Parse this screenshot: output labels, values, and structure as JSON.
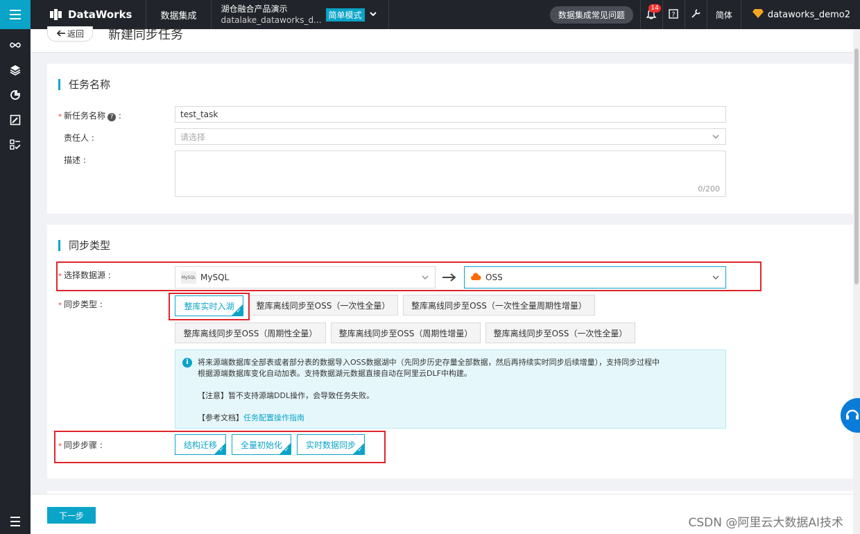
{
  "topbar": {
    "brand": "DataWorks",
    "nav_label": "数据集成",
    "workspace_name": "湖仓融合产品演示",
    "workspace_id": "datalake_dataworks_d...",
    "mode": "简单模式",
    "faq": "数据集成常见问题",
    "notif_count": "14",
    "lang": "简体",
    "user": "dataworks_demo2"
  },
  "header": {
    "back": "返回",
    "title": "新建同步任务"
  },
  "section1": {
    "title": "任务名称",
    "task_name_label": "新任务名称",
    "task_name_value": "test_task",
    "owner_label": "责任人",
    "owner_placeholder": "请选择",
    "desc_label": "描述",
    "desc_counter": "0/200"
  },
  "section2": {
    "title": "同步类型",
    "datasource_label": "选择数据源",
    "source": "MySQL",
    "source_logo": "MySQL",
    "target": "OSS",
    "sync_type_label": "同步类型",
    "sync_types": [
      "整库实时入湖",
      "整库离线同步至OSS（一次性全量）",
      "整库离线同步至OSS（一次性全量周期性增量）",
      "整库离线同步至OSS（周期性全量）",
      "整库离线同步至OSS（周期性增量）",
      "整库离线同步至OSS（一次性全量）"
    ],
    "selected_type_index": 0,
    "info_line1": "将来源端数据库全部表或者部分表的数据导入OSS数据湖中（先同步历史存量全部数据，然后再持续实时同步后续增量），支持同步过程中",
    "info_line2": "根据源端数据库变化自动加表。支持数据湖元数据直接自动在阿里云DLF中构建。",
    "info_note": "【注意】暂不支持源端DDL操作，会导致任务失败。",
    "info_ref_prefix": "【参考文档】",
    "info_ref_link": "任务配置操作指南",
    "steps_label": "同步步骤",
    "steps": [
      "结构迁移",
      "全量初始化",
      "实时数据同步"
    ]
  },
  "footer": {
    "next": "下一步",
    "watermark": "CSDN @阿里云大数据AI技术"
  },
  "colors": {
    "accent": "#0aa4c8",
    "topbar": "#21242b",
    "highlight": "#e0242b"
  }
}
